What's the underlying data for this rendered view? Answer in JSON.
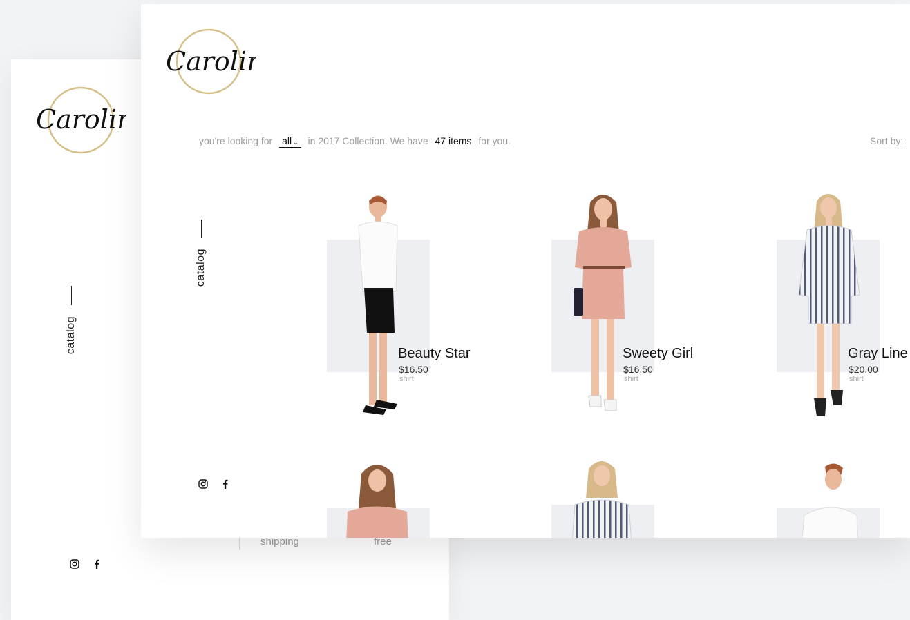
{
  "brand": {
    "logo_text": "Caroline"
  },
  "back_page": {
    "nav_label": "catalog",
    "footer": {
      "label": "shipping",
      "value": "free"
    }
  },
  "front_page": {
    "nav_label": "catalog",
    "filter": {
      "prefix": "you're looking for",
      "selected_category": "all",
      "middle": "in 2017 Collection. We have",
      "count": "47 items",
      "suffix": "for you."
    },
    "sort_label": "Sort by:",
    "products": [
      {
        "name": "Beauty Star",
        "price": "$16.50",
        "category": "shirt"
      },
      {
        "name": "Sweety Girl",
        "price": "$16.50",
        "category": "shirt"
      },
      {
        "name": "Gray Line",
        "price": "$20.00",
        "category": "shirt"
      }
    ]
  },
  "social": [
    "instagram-icon",
    "facebook-icon"
  ],
  "colors": {
    "accent_gold": "#d6c08a",
    "card_bg": "#eeeff2",
    "muted_text": "#9a9a9a"
  }
}
